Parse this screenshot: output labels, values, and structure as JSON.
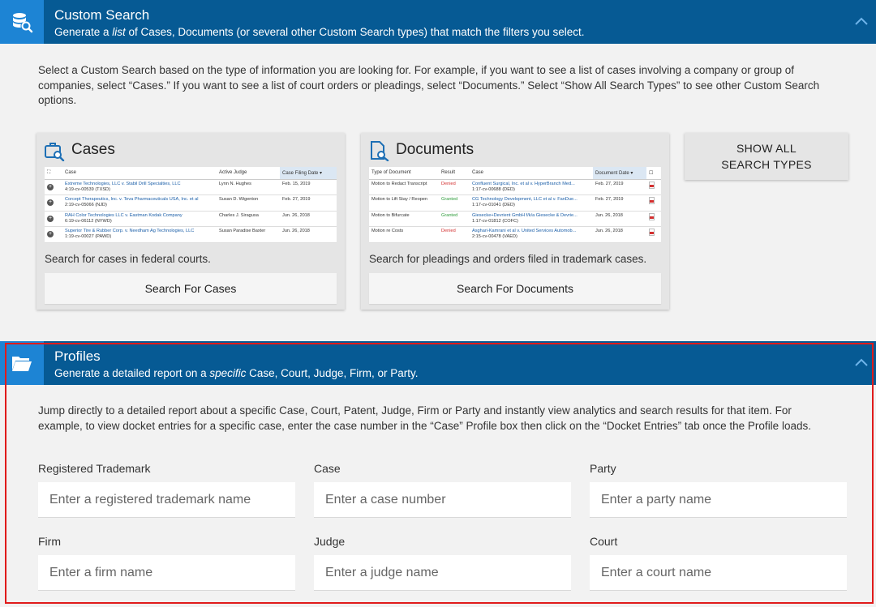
{
  "custom_search": {
    "title": "Custom Search",
    "subtitle_pre": "Generate a ",
    "subtitle_em": "list",
    "subtitle_post": " of Cases, Documents (or several other Custom Search types) that match the filters you select.",
    "intro": "Select a Custom Search based on the type of information you are looking for. For example, if you want to see a list of cases involving a company or group of companies, select “Cases.” If you want to see a list of court orders or pleadings, select “Documents.” Select “Show All Search Types” to see other Custom Search options.",
    "cases_card": {
      "title": "Cases",
      "description": "Search for cases in federal courts.",
      "button": "Search For Cases",
      "preview": {
        "headers": [
          "Case",
          "Active Judge",
          "Case Filing Date"
        ],
        "rows": [
          {
            "case": "Extreme Technologies, LLC v. Stabil Drill Specialties, LLC",
            "number": "4:19-cv-00539 (TXSD)",
            "judge": "Lynn N. Hughes",
            "date": "Feb. 15, 2019"
          },
          {
            "case": "Corcept Therapeutics, Inc. v. Teva Pharmaceuticals USA, Inc. et al",
            "number": "2:19-cv-05066 (NJD)",
            "judge": "Susan D. Wigenton",
            "date": "Feb. 27, 2019"
          },
          {
            "case": "RAH Color Technologies LLC v. Eastman Kodak Company",
            "number": "6:19-cv-06112 (NYWD)",
            "judge": "Charles J. Siragusa",
            "date": "Jun. 26, 2018"
          },
          {
            "case": "Superior Tire & Rubber Corp. v. Needham Ag Technologies, LLC",
            "number": "1:19-cv-00027 (PAWD)",
            "judge": "Susan Paradise Baxter",
            "date": "Jun. 26, 2018"
          }
        ]
      }
    },
    "documents_card": {
      "title": "Documents",
      "description": "Search for pleadings and orders filed in trademark cases.",
      "button": "Search For Documents",
      "preview": {
        "headers": [
          "Type of Document",
          "Result",
          "Case",
          "Document Date"
        ],
        "rows": [
          {
            "type": "Motion to Redact Transcript",
            "result": "Denied",
            "case": "Confluent Surgical, Inc. et al v. HyperBranch Med...",
            "number": "1:17-cv-00688 (DED)",
            "date": "Feb. 27, 2019"
          },
          {
            "type": "Motion to Lift Stay / Reopen",
            "result": "Granted",
            "case": "CG Technology Development, LLC et al v. FanDue...",
            "number": "1:17-cv-01041 (DED)",
            "date": "Feb. 27, 2019"
          },
          {
            "type": "Motion to Bifurcate",
            "result": "Granted",
            "case": "Giesecke+Devrient GmbH f/k/a Giesecke & Devrie...",
            "number": "1:17-cv-01812 (COFC)",
            "date": "Jun. 26, 2018"
          },
          {
            "type": "Motion re Costs",
            "result": "Denied",
            "case": "Asghari-Kamrani et al v. United Services Automob...",
            "number": "2:15-cv-00478 (VAED)",
            "date": "Jun. 26, 2018"
          }
        ]
      }
    },
    "show_all_line1": "SHOW ALL",
    "show_all_line2": "SEARCH TYPES"
  },
  "profiles": {
    "title": "Profiles",
    "subtitle_pre": "Generate a detailed report on a ",
    "subtitle_em": "specific",
    "subtitle_post": " Case, Court, Judge, Firm, or Party.",
    "intro": "Jump directly to a detailed report about a specific Case, Court, Patent, Judge, Firm or Party and instantly view analytics and search results for that item. For example, to view docket entries for a specific case, enter the case number in the “Case” Profile box then click on the “Docket Entries” tab once the Profile loads.",
    "fields": {
      "trademark": {
        "label": "Registered Trademark",
        "placeholder": "Enter a registered trademark name"
      },
      "case": {
        "label": "Case",
        "placeholder": "Enter a case number"
      },
      "party": {
        "label": "Party",
        "placeholder": "Enter a party name"
      },
      "firm": {
        "label": "Firm",
        "placeholder": "Enter a firm name"
      },
      "judge": {
        "label": "Judge",
        "placeholder": "Enter a judge name"
      },
      "court": {
        "label": "Court",
        "placeholder": "Enter a court name"
      }
    }
  },
  "colors": {
    "header_bg": "#065a94",
    "icon_bg": "#1d84d4",
    "highlight": "#e01b1b"
  }
}
